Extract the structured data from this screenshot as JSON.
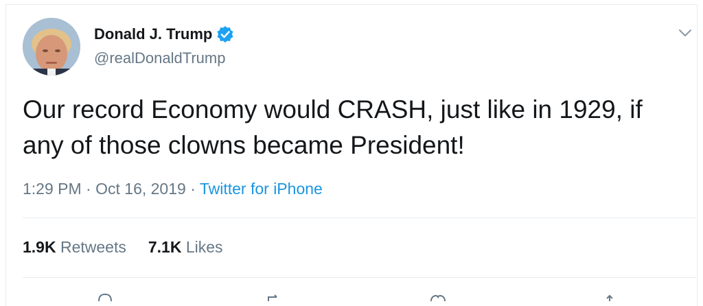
{
  "author": {
    "display_name": "Donald J. Trump",
    "handle": "@realDonaldTrump",
    "verified": true,
    "avatar": "profile-photo"
  },
  "tweet": {
    "text": "Our record Economy would CRASH, just like in 1929, if any of those clowns became President!"
  },
  "meta": {
    "time": "1:29 PM",
    "sep1": " · ",
    "date": "Oct 16, 2019",
    "sep2": " · ",
    "source": "Twitter for iPhone"
  },
  "stats": {
    "retweets_count": "1.9K",
    "retweets_label": " Retweets",
    "likes_count": "7.1K",
    "likes_label": " Likes"
  },
  "icons": {
    "verified": "verified-badge-icon",
    "caret": "chevron-down-icon",
    "actions": [
      "reply-icon",
      "retweet-icon",
      "like-icon",
      "share-icon"
    ]
  },
  "colors": {
    "text_primary": "#14171a",
    "text_secondary": "#657786",
    "accent": "#1b95e0",
    "verified": "#1da1f2",
    "divider": "#e6ecf0"
  }
}
